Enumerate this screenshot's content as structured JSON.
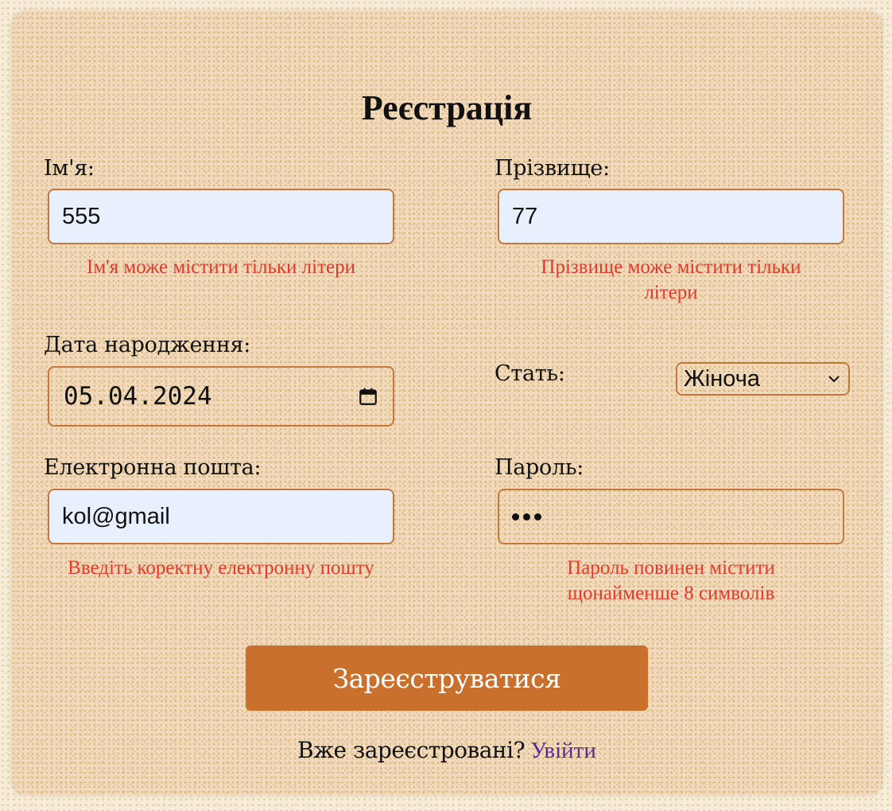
{
  "form": {
    "title": "Реєстрація",
    "first_name": {
      "label": "Ім'я:",
      "value": "555",
      "error": "Ім'я може містити тільки літери"
    },
    "last_name": {
      "label": "Прізвище:",
      "value": "77",
      "error_line1": "Прізвище може містити тільки",
      "error_line2": "літери"
    },
    "birth_date": {
      "label": "Дата народження:",
      "value": "05.04.2024",
      "icon": "calendar-icon"
    },
    "gender": {
      "label": "Стать:",
      "value": "Жіноча",
      "icon": "chevron-down-icon"
    },
    "email": {
      "label": "Електронна пошта:",
      "value": "kol@gmail",
      "error": "Введіть коректну електронну пошту"
    },
    "password": {
      "label": "Пароль:",
      "masked_length": 3,
      "error_line1": "Пароль повинен містити",
      "error_line2": "щонайменше 8 символів"
    },
    "submit_label": "Зареєструватися",
    "login_prompt": "Вже зареєстровані?",
    "login_link": "Увійти"
  },
  "colors": {
    "accent": "#c9712c",
    "border": "#c8773a",
    "error": "#e23a2e",
    "link": "#5a2d9a",
    "autofill_bg": "#e8f0fe",
    "card_bg": "#f2d9bd"
  }
}
